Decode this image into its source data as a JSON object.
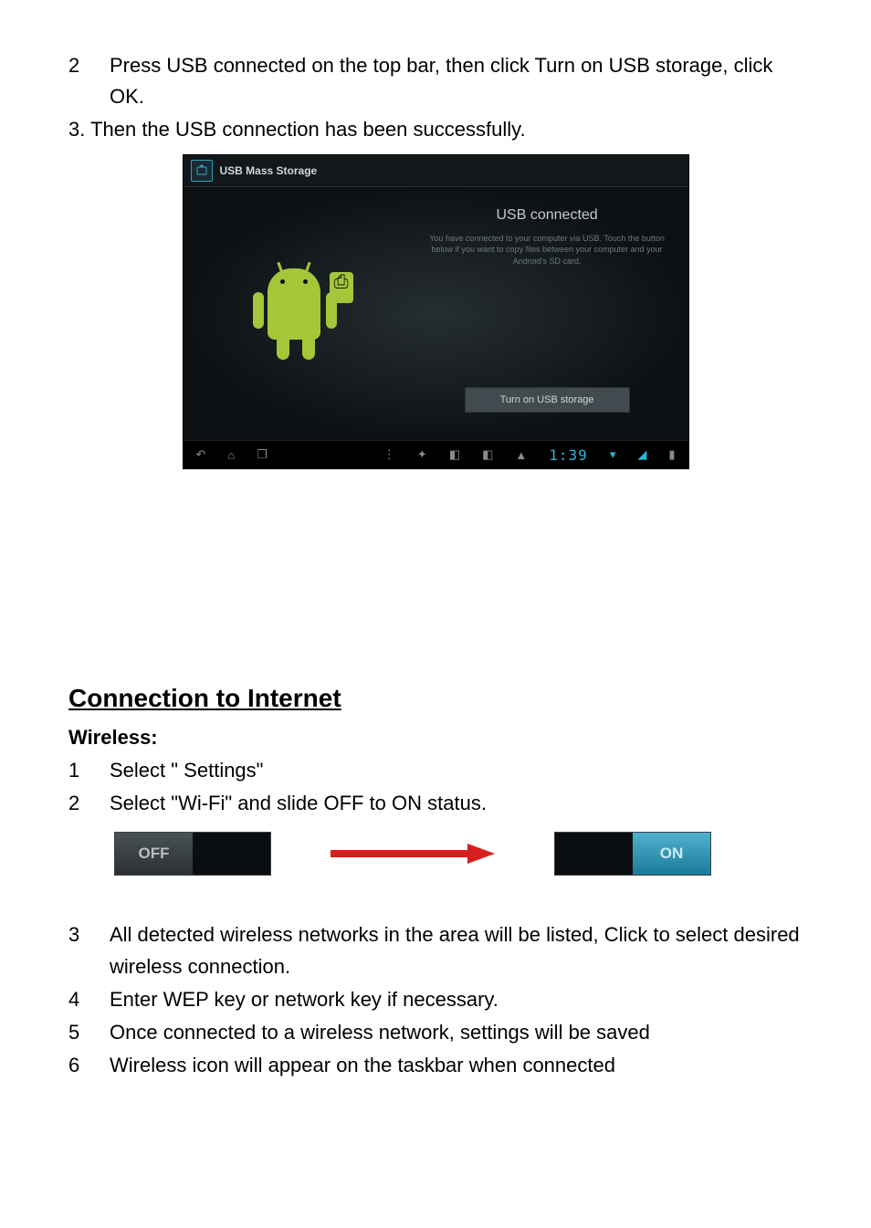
{
  "top_list": {
    "item2_num": "2",
    "item2_text": "Press USB connected on the top bar, then click Turn on USB storage, click OK.",
    "item3_text": "3. Then the USB connection has been successfully."
  },
  "android": {
    "title": "USB Mass Storage",
    "heading": "USB connected",
    "desc": "You have connected to your computer via USB. Touch the button below if you want to copy files between your computer and your Android's SD card.",
    "button": "Turn on USB storage",
    "clock": "1:39"
  },
  "section": {
    "title": "Connection to Internet",
    "subtitle": "Wireless:"
  },
  "wifi_steps": {
    "s1_num": "1",
    "s1_text": "Select \" Settings\"",
    "s2_num": "2",
    "s2_text": "Select \"Wi-Fi\" and slide OFF to ON status.",
    "s3_num": "3",
    "s3_text": "All detected wireless networks in the area will be listed, Click to select desired wireless connection.",
    "s4_num": "4",
    "s4_text": "Enter WEP key or network key if necessary.",
    "s5_num": "5",
    "s5_text": "Once connected to a wireless network, settings will be saved",
    "s6_num": "6",
    "s6_text": "Wireless icon will appear on the taskbar when connected"
  },
  "toggle": {
    "off": "OFF",
    "on": "ON"
  }
}
